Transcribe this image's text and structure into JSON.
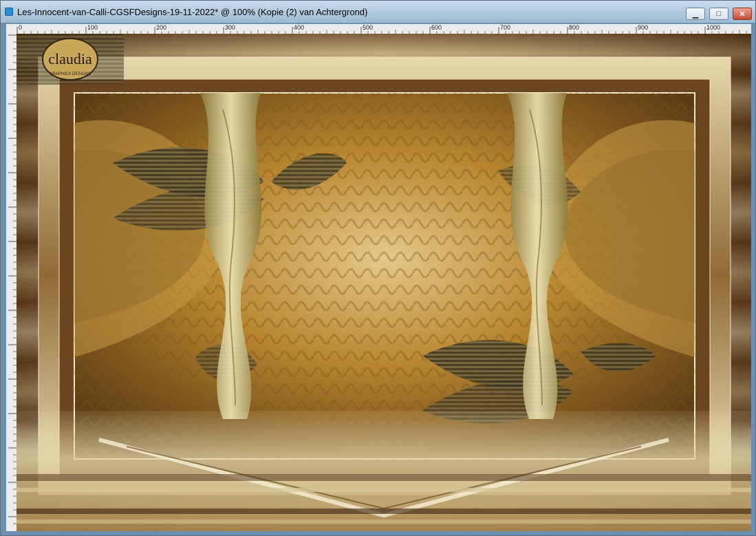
{
  "window": {
    "title": "Les-Innocent-van-Calli-CGSFDesigns-19-11-2022* @ 100% (Kopie (2) van Achtergrond)",
    "buttons": {
      "minimize_icon": "minimize-icon",
      "maximize_icon": "maximize-icon",
      "close_icon": "close-icon"
    }
  },
  "ruler": {
    "top_labels": [
      "0",
      "100",
      "200",
      "300",
      "400",
      "500",
      "600",
      "700",
      "800",
      "900",
      "1000"
    ],
    "left_labels": [
      "50",
      "100",
      "150",
      "200",
      "250",
      "300",
      "350",
      "400",
      "450",
      "500",
      "550",
      "600",
      "650",
      "700"
    ]
  },
  "canvas": {
    "watermark": {
      "text": "claudia",
      "subtext": "GRAPHICS DESIGNS"
    }
  },
  "colors": {
    "frame_dark": "#4a2b14",
    "frame_light": "#e8ddb8",
    "gold": "#b8862f",
    "pale_gold": "#d8d2a0",
    "shadow": "#3a3320"
  }
}
